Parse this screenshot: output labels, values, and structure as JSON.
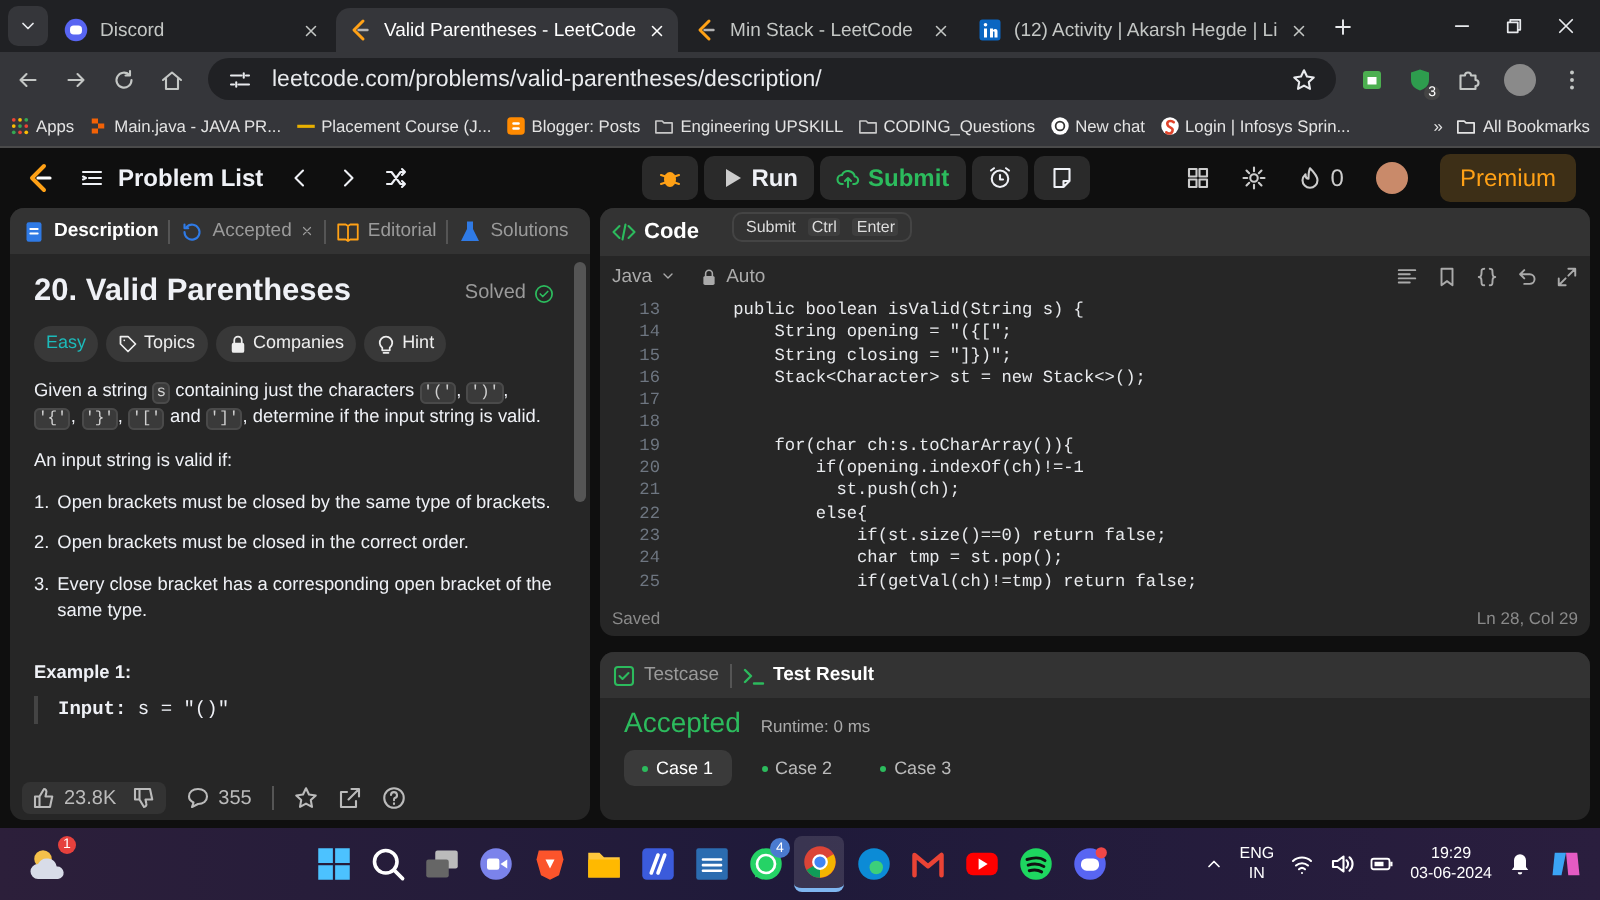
{
  "browser": {
    "tabs": [
      {
        "title": "Discord",
        "kind": "discord",
        "selected": false
      },
      {
        "title": "Valid Parentheses - LeetCode",
        "kind": "leetcode",
        "selected": true
      },
      {
        "title": "Min Stack - LeetCode",
        "kind": "leetcode",
        "selected": false
      },
      {
        "title": "(12) Activity | Akarsh Hegde | Li",
        "kind": "linkedin",
        "selected": false
      }
    ],
    "address": "leetcode.com/problems/valid-parentheses/description/",
    "extension_badge": "3",
    "bookmarks": [
      {
        "label": "Apps",
        "kind": "apps"
      },
      {
        "label": "Main.java - JAVA PR...",
        "kind": "replit"
      },
      {
        "label": "Placement Course (J...",
        "kind": "dash"
      },
      {
        "label": "Blogger: Posts",
        "kind": "blogger"
      },
      {
        "label": "Engineering UPSKILL",
        "kind": "folder"
      },
      {
        "label": "CODING_Questions",
        "kind": "folder"
      },
      {
        "label": "New chat",
        "kind": "chat"
      },
      {
        "label": "Login | Infosys Sprin...",
        "kind": "swirl"
      }
    ],
    "bookmarks_overflow": "»",
    "all_bookmarks": "All Bookmarks"
  },
  "toolbar": {
    "problem_list": "Problem List",
    "run": "Run",
    "submit": "Submit",
    "streak": "0",
    "premium": "Premium"
  },
  "tooltip": {
    "label": "Submit",
    "keys": [
      "Ctrl",
      "Enter"
    ]
  },
  "description_panel": {
    "tabs": [
      {
        "label": "Description",
        "kind": "description",
        "selected": true,
        "closable": false
      },
      {
        "label": "Accepted",
        "kind": "accepted",
        "selected": false,
        "closable": true
      },
      {
        "label": "Editorial",
        "kind": "editorial",
        "selected": false,
        "closable": false
      },
      {
        "label": "Solutions",
        "kind": "solutions",
        "selected": false,
        "closable": false
      }
    ],
    "title": "20. Valid Parentheses",
    "status": "Solved",
    "tags": [
      {
        "label": "Easy",
        "kind": "difficulty"
      },
      {
        "label": "Topics",
        "kind": "topics"
      },
      {
        "label": "Companies",
        "kind": "companies"
      },
      {
        "label": "Hint",
        "kind": "hint"
      }
    ],
    "intro": [
      {
        "text": "Given a string ",
        "kind": "text"
      },
      {
        "text": "s",
        "kind": "code"
      },
      {
        "text": " containing just the characters ",
        "kind": "text"
      },
      {
        "text": "'('",
        "kind": "code"
      },
      {
        "text": ", ",
        "kind": "text"
      },
      {
        "text": "')'",
        "kind": "code"
      },
      {
        "text": ", ",
        "kind": "text"
      },
      {
        "text": "'{'",
        "kind": "code"
      },
      {
        "text": ", ",
        "kind": "text"
      },
      {
        "text": "'}'",
        "kind": "code"
      },
      {
        "text": ", ",
        "kind": "text"
      },
      {
        "text": "'['",
        "kind": "code"
      },
      {
        "text": " and ",
        "kind": "text"
      },
      {
        "text": "']'",
        "kind": "code"
      },
      {
        "text": ", determine if the input string is valid.",
        "kind": "text"
      }
    ],
    "condition_intro": "An input string is valid if:",
    "rules": [
      {
        "marker": "1.",
        "text": "Open brackets must be closed by the same type of brackets."
      },
      {
        "marker": "2.",
        "text": "Open brackets must be closed in the correct order."
      },
      {
        "marker": "3.",
        "text": "Every close bracket has a corresponding open bracket of the same type."
      }
    ],
    "example_heading": "Example 1:",
    "example_input": "**Input:** s = \"()\"",
    "likes": "23.8K",
    "comments": "355"
  },
  "code_panel": {
    "tab": "Code",
    "language": "Java",
    "mode": "Auto",
    "lines": [
      {
        "num": "13",
        "text": "    public boolean isValid(String s) {"
      },
      {
        "num": "14",
        "text": "        String opening = \"({[\";"
      },
      {
        "num": "15",
        "text": "        String closing = \"]})\";"
      },
      {
        "num": "16",
        "text": "        Stack<Character> st = new Stack<>();"
      },
      {
        "num": "17"
      },
      {
        "num": "18"
      },
      {
        "num": "19",
        "text": "        for(char ch:s.toCharArray()){"
      },
      {
        "num": "20",
        "text": "            if(opening.indexOf(ch)!=-1"
      },
      {
        "num": "21",
        "text": "              st.push(ch);"
      },
      {
        "num": "22",
        "text": "            else{"
      },
      {
        "num": "23",
        "text": "                if(st.size()==0) return false;"
      },
      {
        "num": "24",
        "text": "                char tmp = st.pop();"
      },
      {
        "num": "25",
        "text": "                if(getVal(ch)!=tmp) return false;"
      }
    ],
    "status": "Saved",
    "cursor": "Ln 28, Col 29"
  },
  "result_panel": {
    "tabs": [
      {
        "label": "Testcase",
        "kind": "testcase",
        "selected": false
      },
      {
        "label": "Test Result",
        "kind": "result",
        "selected": true
      }
    ],
    "verdict": "Accepted",
    "runtime": "Runtime: 0 ms",
    "cases": [
      {
        "label": "Case 1",
        "selected": true
      },
      {
        "label": "Case 2",
        "selected": false
      },
      {
        "label": "Case 3",
        "selected": false
      }
    ]
  },
  "taskbar": {
    "weather_badge": "1",
    "apps": [
      {
        "kind": "start",
        "active": false
      },
      {
        "kind": "search",
        "active": false
      },
      {
        "kind": "taskview",
        "active": false
      },
      {
        "kind": "meet",
        "active": false
      },
      {
        "kind": "brave",
        "active": false
      },
      {
        "kind": "files",
        "active": false
      },
      {
        "kind": "tile",
        "active": false
      },
      {
        "kind": "tile2",
        "active": false
      },
      {
        "kind": "whatsapp",
        "active": false,
        "badge": "4"
      },
      {
        "kind": "chrome",
        "active": true
      },
      {
        "kind": "edge",
        "active": false
      },
      {
        "kind": "gmail",
        "active": false
      },
      {
        "kind": "youtube",
        "active": false
      },
      {
        "kind": "spotify",
        "active": false
      },
      {
        "kind": "discord",
        "active": false
      }
    ],
    "language": "ENG",
    "region": "IN",
    "time": "19:29",
    "date": "03-06-2024"
  }
}
